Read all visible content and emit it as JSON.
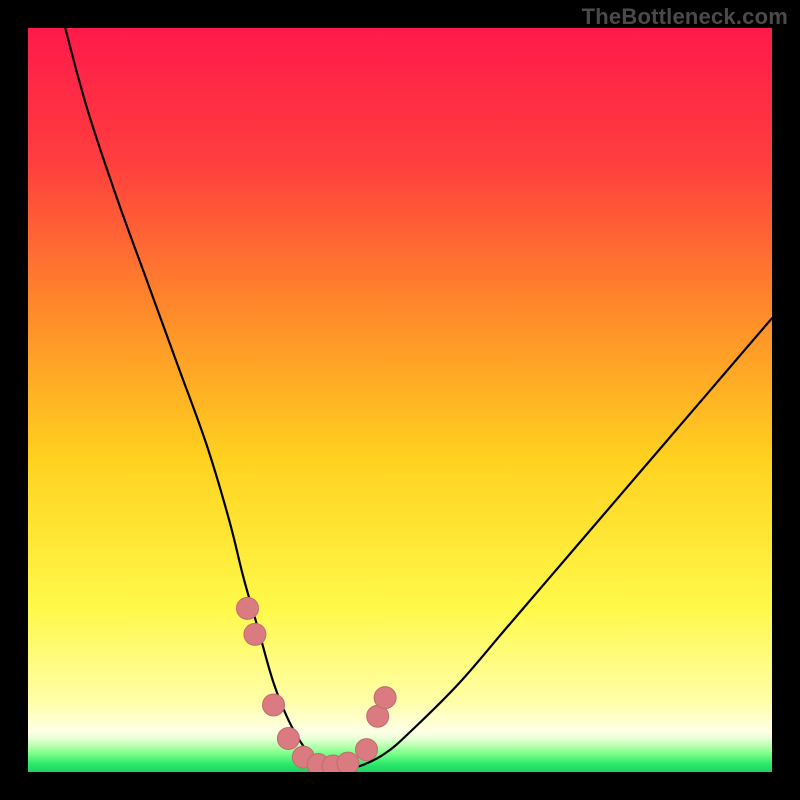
{
  "watermark": "TheBottleneck.com",
  "colors": {
    "frame": "#000000",
    "curve": "#000000",
    "marker_fill": "#d97b80",
    "marker_stroke": "#c46a70",
    "gradient_stops": [
      {
        "offset": 0.0,
        "color": "#ff1a4b"
      },
      {
        "offset": 0.18,
        "color": "#ff3e3e"
      },
      {
        "offset": 0.38,
        "color": "#ff8a2a"
      },
      {
        "offset": 0.58,
        "color": "#ffd21f"
      },
      {
        "offset": 0.78,
        "color": "#fff94a"
      },
      {
        "offset": 0.905,
        "color": "#ffffa8"
      },
      {
        "offset": 0.945,
        "color": "#ffffe6"
      },
      {
        "offset": 0.955,
        "color": "#e8ffd6"
      },
      {
        "offset": 0.965,
        "color": "#b8ffb0"
      },
      {
        "offset": 0.975,
        "color": "#7cff8a"
      },
      {
        "offset": 0.99,
        "color": "#28e86a"
      },
      {
        "offset": 1.0,
        "color": "#1fd062"
      }
    ]
  },
  "chart_data": {
    "type": "line",
    "title": "",
    "xlabel": "",
    "ylabel": "",
    "xlim": [
      0,
      100
    ],
    "ylim": [
      0,
      100
    ],
    "grid": false,
    "legend": false,
    "series": [
      {
        "name": "bottleneck-curve",
        "x": [
          5,
          8,
          12,
          16,
          20,
          24,
          27,
          29,
          31,
          33,
          35,
          37,
          39,
          41,
          44,
          48,
          52,
          58,
          64,
          70,
          76,
          82,
          88,
          94,
          100
        ],
        "values": [
          100,
          89,
          77,
          66,
          55,
          44,
          34,
          26,
          19,
          12,
          7,
          3.5,
          1.2,
          0.4,
          0.6,
          2.5,
          6,
          12,
          19,
          26,
          33,
          40,
          47,
          54,
          61
        ]
      }
    ],
    "markers": {
      "name": "highlighted-points",
      "x": [
        29.5,
        30.5,
        33.0,
        35.0,
        37.0,
        39.0,
        41.0,
        43.0,
        45.5,
        47.0,
        48.0
      ],
      "values": [
        22.0,
        18.5,
        9.0,
        4.5,
        2.0,
        1.0,
        0.8,
        1.2,
        3.0,
        7.5,
        10.0
      ]
    }
  }
}
